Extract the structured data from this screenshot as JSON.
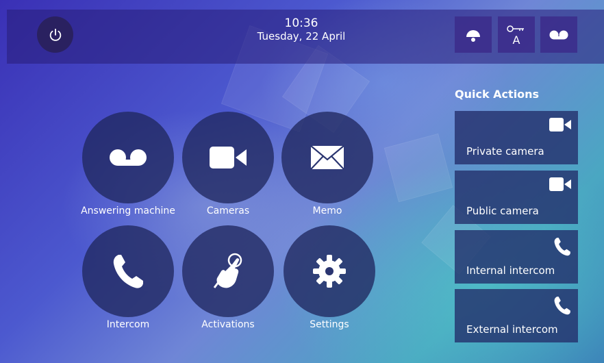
{
  "header": {
    "time": "10:36",
    "date": "Tuesday, 22 April",
    "buttons": [
      {
        "icon": "bell-icon"
      },
      {
        "icon": "key-a-icon",
        "text": "A"
      },
      {
        "icon": "answering-machine-icon"
      }
    ]
  },
  "tiles": [
    {
      "label": "Answering machine",
      "icon": "answering-machine-icon"
    },
    {
      "label": "Cameras",
      "icon": "camera-icon"
    },
    {
      "label": "Memo",
      "icon": "envelope-icon"
    },
    {
      "label": "Intercom",
      "icon": "phone-icon"
    },
    {
      "label": "Activations",
      "icon": "hand-pointer-icon"
    },
    {
      "label": "Settings",
      "icon": "gear-icon"
    }
  ],
  "quick_actions": {
    "title": "Quick Actions",
    "items": [
      {
        "label": "Private camera",
        "icon": "camera-icon"
      },
      {
        "label": "Public camera",
        "icon": "camera-icon"
      },
      {
        "label": "Internal intercom",
        "icon": "phone-icon"
      },
      {
        "label": "External intercom",
        "icon": "phone-icon"
      }
    ]
  }
}
